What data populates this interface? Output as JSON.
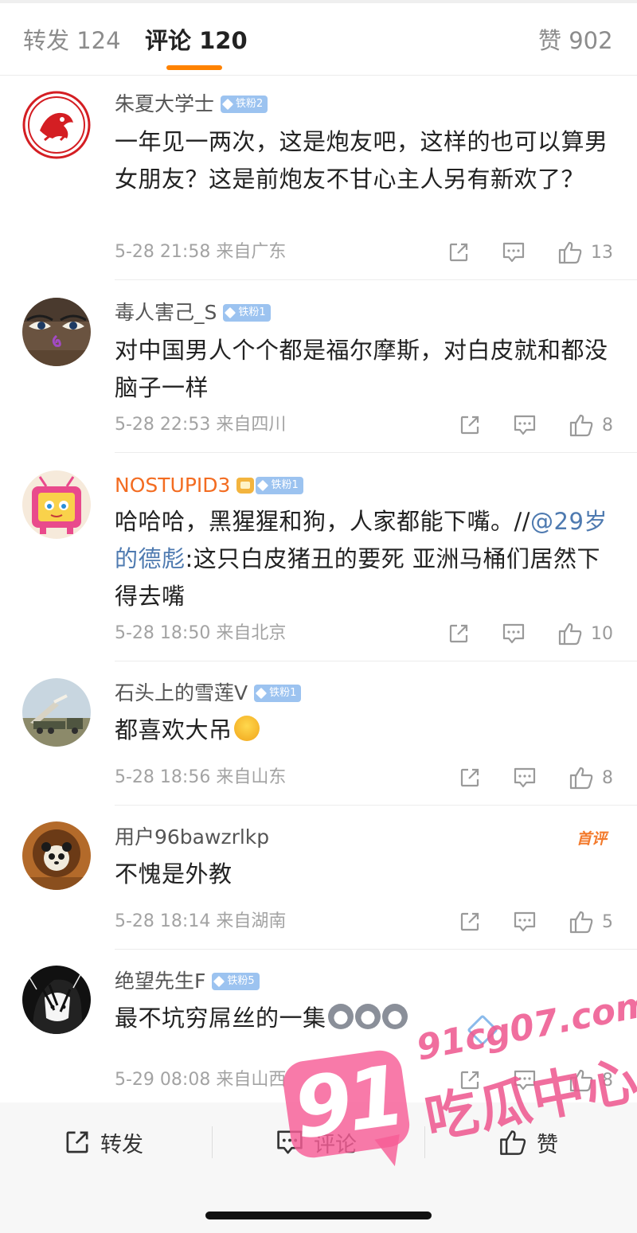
{
  "tabs": {
    "repost": "转发 124",
    "comments": "评论 120",
    "likes": "赞 902"
  },
  "comments": [
    {
      "username": "朱夏大学士",
      "badge": "铁粉2",
      "text": "一年见一两次，这是炮友吧，这样的也可以算男女朋友？这是前炮友不甘心主人另有新欢了？",
      "time": "5-28 21:58",
      "location": "来自广东",
      "likes": "13",
      "avatar": "red-tiger-seal"
    },
    {
      "username": "毒人害己_S",
      "badge": "铁粉1",
      "text": "对中国男人个个都是福尔摩斯，对白皮就和都没脑子一样",
      "time": "5-28 22:53",
      "location": "来自四川",
      "likes": "8",
      "avatar": "buddha-eyes"
    },
    {
      "username": "NOSTUPID3",
      "badge": "铁粉1",
      "text_before": "哈哈哈，黑猩猩和狗，人家都能下嘴。//",
      "mention": "@29岁的德彪",
      "text_after": ":这只白皮猪丑的要死 亚洲马桶们居然下得去嘴",
      "time": "5-28 18:50",
      "location": "来自北京",
      "likes": "10",
      "avatar": "pink-tv-character"
    },
    {
      "username": "石头上的雪莲V",
      "badge": "铁粉1",
      "text": "都喜欢大吊",
      "emoji": "laugh-cry-emoji",
      "time": "5-28 18:56",
      "location": "来自山东",
      "likes": "8",
      "avatar": "missile-launch"
    },
    {
      "username": "用户96bawzrlkp",
      "tag": "首评",
      "text": "不愧是外教",
      "time": "5-28 18:14",
      "location": "来自湖南",
      "likes": "5",
      "avatar": "panda-painting"
    },
    {
      "username": "绝望先生F",
      "badge": "铁粉5",
      "text": "最不坑穷屌丝的一集",
      "emoji": "husky-emoji",
      "time": "5-29 08:08",
      "location": "来自山西",
      "likes": "8",
      "avatar": "anime-girl-sketch"
    }
  ],
  "bottom_bar": {
    "repost": "转发",
    "comment": "评论",
    "like": "赞"
  },
  "watermark": {
    "number": "91",
    "url": "91cg07.com",
    "name": "吃瓜中心"
  },
  "colors": {
    "accent": "#ff8200",
    "mention": "#4e7ab0",
    "badge": "#9cc3f0",
    "watermark": "#ee5a91"
  }
}
